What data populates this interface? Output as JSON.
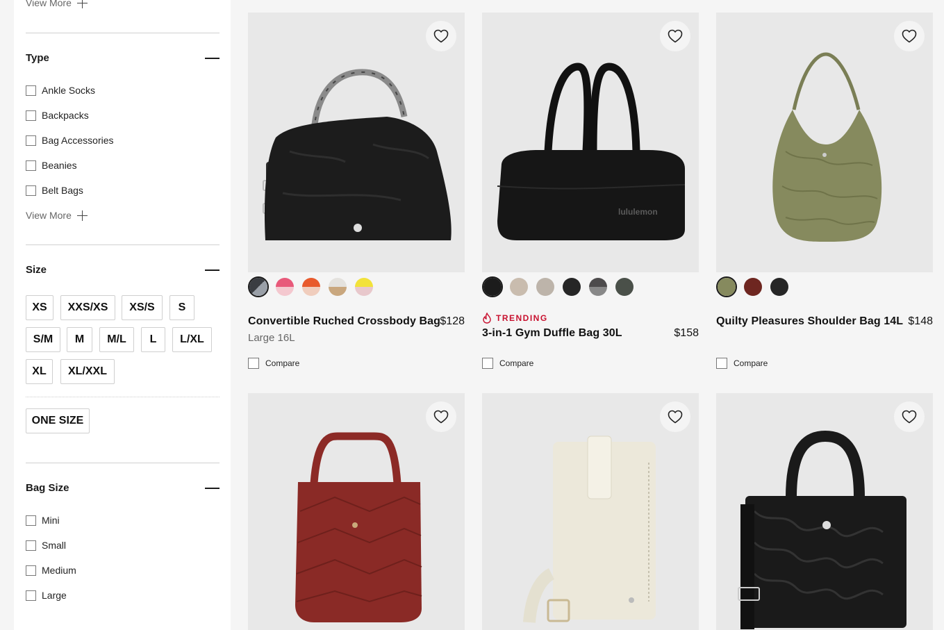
{
  "filters": {
    "view_more_label": "View More",
    "type": {
      "title": "Type",
      "options": [
        "Ankle Socks",
        "Backpacks",
        "Bag Accessories",
        "Beanies",
        "Belt Bags"
      ],
      "view_more_label": "View More"
    },
    "size": {
      "title": "Size",
      "options": [
        "XS",
        "XXS/XS",
        "XS/S",
        "S",
        "S/M",
        "M",
        "M/L",
        "L",
        "L/XL",
        "XL",
        "XL/XXL"
      ],
      "one_size": "ONE SIZE"
    },
    "bag_size": {
      "title": "Bag Size",
      "options": [
        "Mini",
        "Small",
        "Medium",
        "Large"
      ]
    }
  },
  "products": [
    {
      "name": "Convertible Ruched Crossbody Bag",
      "sub": "Large 16L",
      "price": "$128",
      "compare_label": "Compare",
      "swatches": [
        "#3a3d42",
        "#e8597a",
        "#e85a2c",
        "#c9a77e",
        "#f2e23a"
      ],
      "selected_swatch": 0
    },
    {
      "badge": "TRENDING",
      "name": "3-in-1 Gym Duffle Bag 30L",
      "price": "$158",
      "compare_label": "Compare",
      "swatches": [
        "#1c1c1c",
        "#c9bcae",
        "#bdb4aa",
        "#262626",
        "#4d4b4c",
        "#4a5049"
      ],
      "selected_swatch": 0,
      "image_text": "lululemon"
    },
    {
      "name": "Quilty Pleasures Shoulder Bag 14L",
      "price": "$148",
      "compare_label": "Compare",
      "swatches": [
        "#868a5e",
        "#6e2620",
        "#262626"
      ],
      "selected_swatch": 0
    },
    {
      "name": "",
      "price": ""
    },
    {
      "name": "",
      "price": ""
    },
    {
      "name": "",
      "price": ""
    }
  ],
  "colors": {
    "trending": "#c8102e",
    "page_bg": "#f5f5f5",
    "image_bg": "#e8e8e8"
  },
  "icons": {
    "wishlist": "heart-icon",
    "trending": "flame-icon",
    "expand": "plus-icon",
    "collapse": "minus-icon"
  }
}
